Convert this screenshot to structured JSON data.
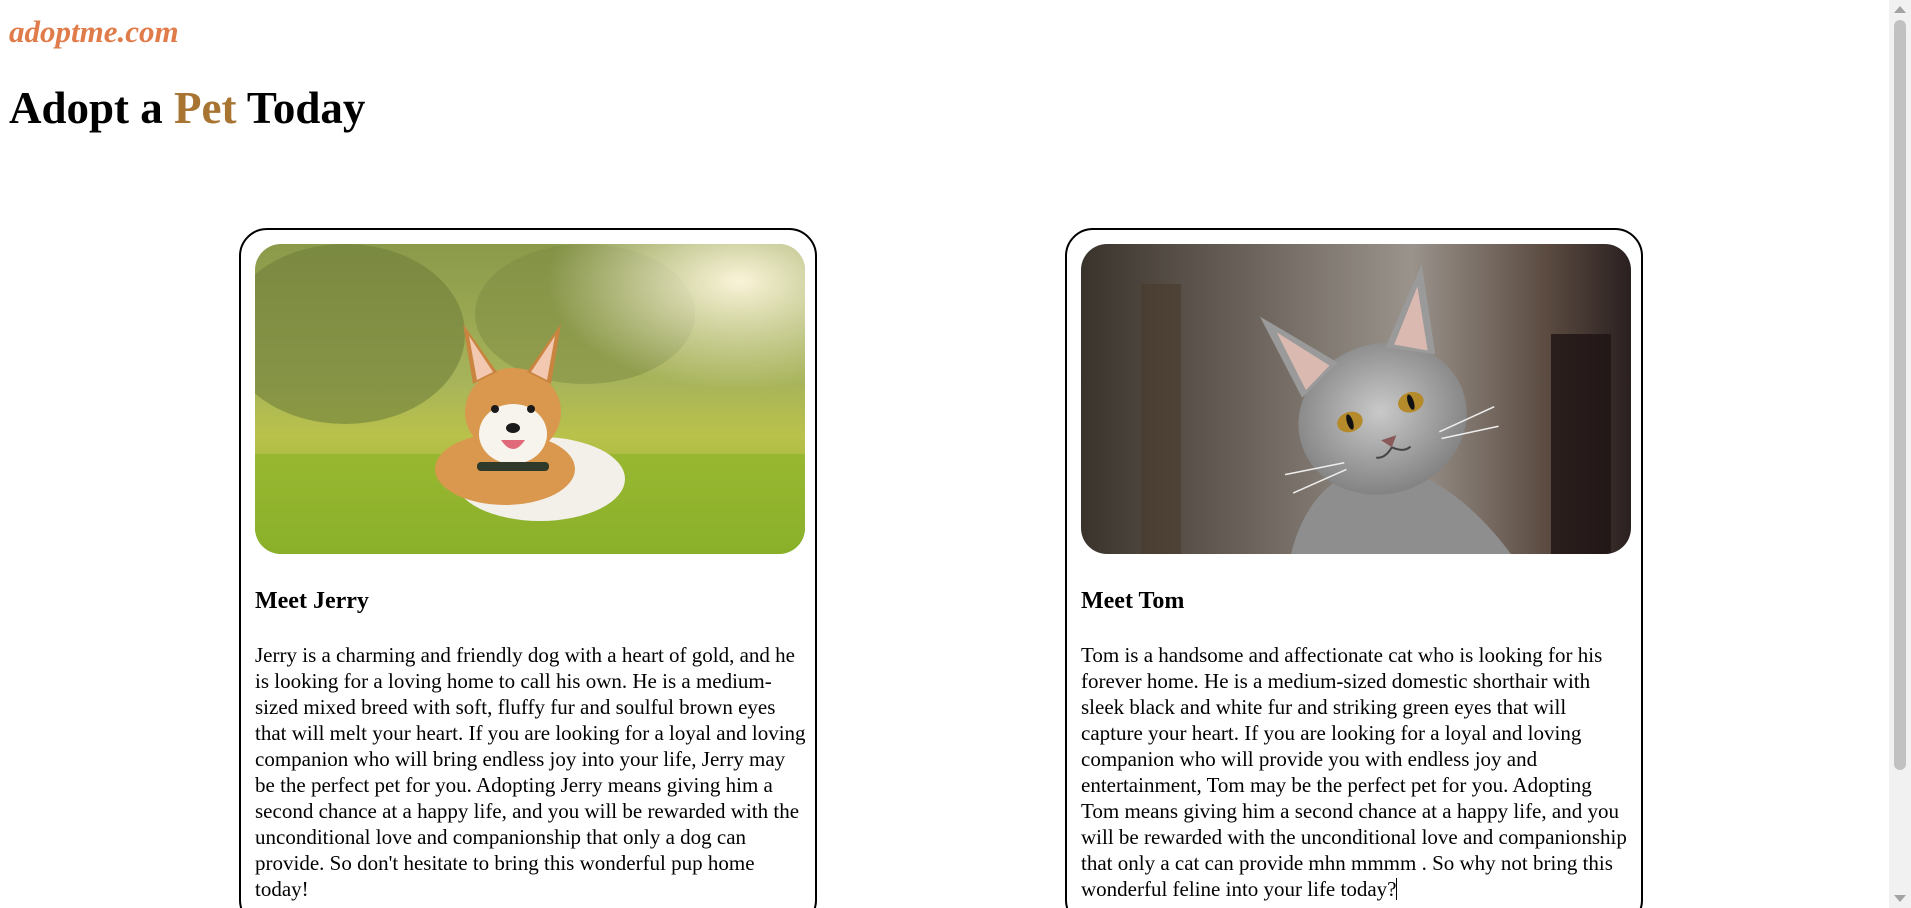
{
  "site": {
    "logo": "adoptme.com",
    "headline_part1": "Adopt a ",
    "headline_accent": "Pet",
    "headline_part2": " Today"
  },
  "colors": {
    "logo": "#e07b4a",
    "accent": "#a87432"
  },
  "pets": [
    {
      "title": "Meet Jerry",
      "image": "corgi-photo",
      "description": "Jerry is a charming and friendly dog with a heart of gold, and he is looking for a loving home to call his own. He is a medium-sized mixed breed with soft, fluffy fur and soulful brown eyes that will melt your heart. If you are looking for a loyal and loving companion who will bring endless joy into your life, Jerry may be the perfect pet for you. Adopting Jerry means giving him a second chance at a happy life, and you will be rewarded with the unconditional love and companionship that only a dog can provide. So don't hesitate to bring this wonderful pup home today!"
    },
    {
      "title": "Meet Tom",
      "image": "cat-photo",
      "description": "Tom is a handsome and affectionate cat who is looking for his forever home. He is a medium-sized domestic shorthair with sleek black and white fur and striking green eyes that will capture your heart. If you are looking for a loyal and loving companion who will provide you with endless joy and entertainment, Tom may be the perfect pet for you. Adopting Tom means giving him a second chance at a happy life, and you will be rewarded with the unconditional love and companionship that only a cat can provide mhn mmmm . So why not bring this wonderful feline into your life today?"
    }
  ]
}
